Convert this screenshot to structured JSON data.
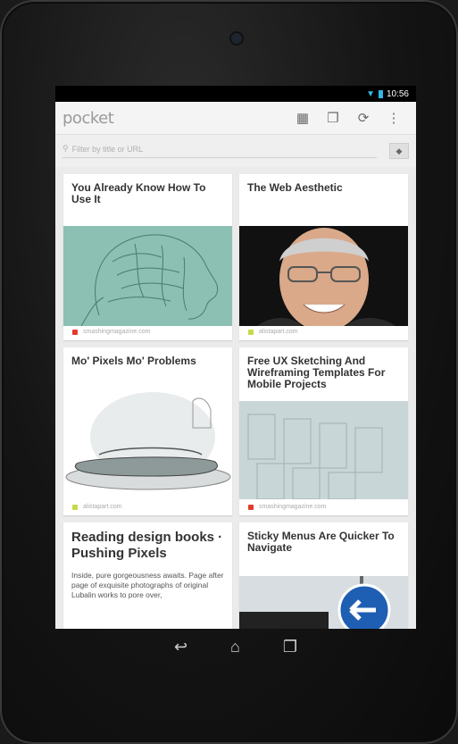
{
  "status": {
    "time": "10:56"
  },
  "app": {
    "logo": "pocket"
  },
  "actionbar": {
    "icons": [
      "grid-icon",
      "list-icon",
      "refresh-icon",
      "overflow-menu-icon"
    ]
  },
  "search": {
    "placeholder": "Filter by title or URL"
  },
  "cards": [
    {
      "title": "You Already Know How To Use It",
      "source": "smashingmagazine.com"
    },
    {
      "title": "The Web Aesthetic",
      "source": "alistapart.com"
    },
    {
      "title": "Mo' Pixels Mo' Problems",
      "source": "alistapart.com"
    },
    {
      "title": "Free UX Sketching And Wireframing Templates For Mobile Projects",
      "source": "smashingmagazine.com"
    },
    {
      "title": "Reading design books · Pushing Pixels",
      "excerpt": "Inside, pure gorgeousness awaits. Page after page of exquisite photographs of original Lubalin works to pore over,"
    },
    {
      "title": "Sticky Menus Are Quicker To Navigate"
    }
  ],
  "colors": {
    "smashing": "#e53b2c",
    "alistapart": "#c8d94a",
    "accent": "#33b5e5"
  }
}
